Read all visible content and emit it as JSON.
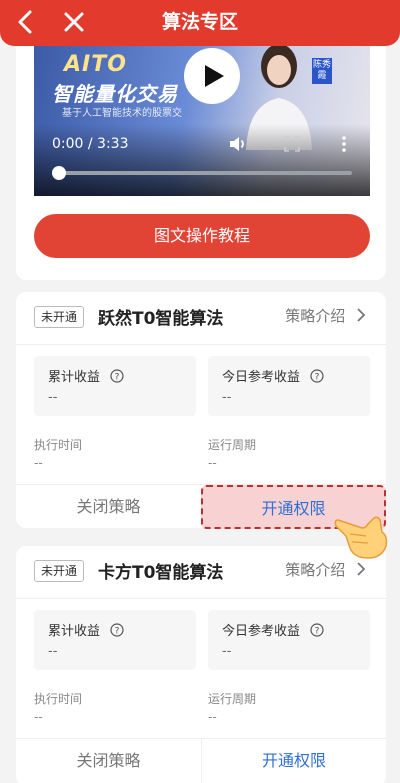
{
  "header": {
    "title": "算法专区",
    "back_icon": "back-arrow-icon",
    "close_icon": "close-icon",
    "color": "#e23a2d"
  },
  "video": {
    "logo_text": "AITO",
    "headline": "智能量化交易",
    "tagline": "基于人工智能技术的股票交",
    "presenter_tag": "陈秀霞",
    "time_display": "0:00 / 3:33",
    "progress_fraction": 0.0
  },
  "tutorial_button": {
    "label": "图文操作教程",
    "color": "#e14335"
  },
  "algorithms": [
    {
      "status": "未开通",
      "name": "跃然T0智能算法",
      "intro_label": "策略介绍",
      "stats": [
        {
          "label": "累计收益",
          "value": "--"
        },
        {
          "label": "今日参考收益",
          "value": "--"
        }
      ],
      "meta": [
        {
          "label": "执行时间",
          "value": "--"
        },
        {
          "label": "运行周期",
          "value": "--"
        }
      ],
      "close_label": "关闭策略",
      "open_label": "开通权限",
      "highlighted": true
    },
    {
      "status": "未开通",
      "name": "卡方T0智能算法",
      "intro_label": "策略介绍",
      "stats": [
        {
          "label": "累计收益",
          "value": "--"
        },
        {
          "label": "今日参考收益",
          "value": "--"
        }
      ],
      "meta": [
        {
          "label": "执行时间",
          "value": "--"
        },
        {
          "label": "运行周期",
          "value": "--"
        }
      ],
      "close_label": "关闭策略",
      "open_label": "开通权限",
      "highlighted": false
    }
  ],
  "colors": {
    "accent_blue": "#2f6fd6",
    "highlight_bg": "#f8d2d2"
  }
}
